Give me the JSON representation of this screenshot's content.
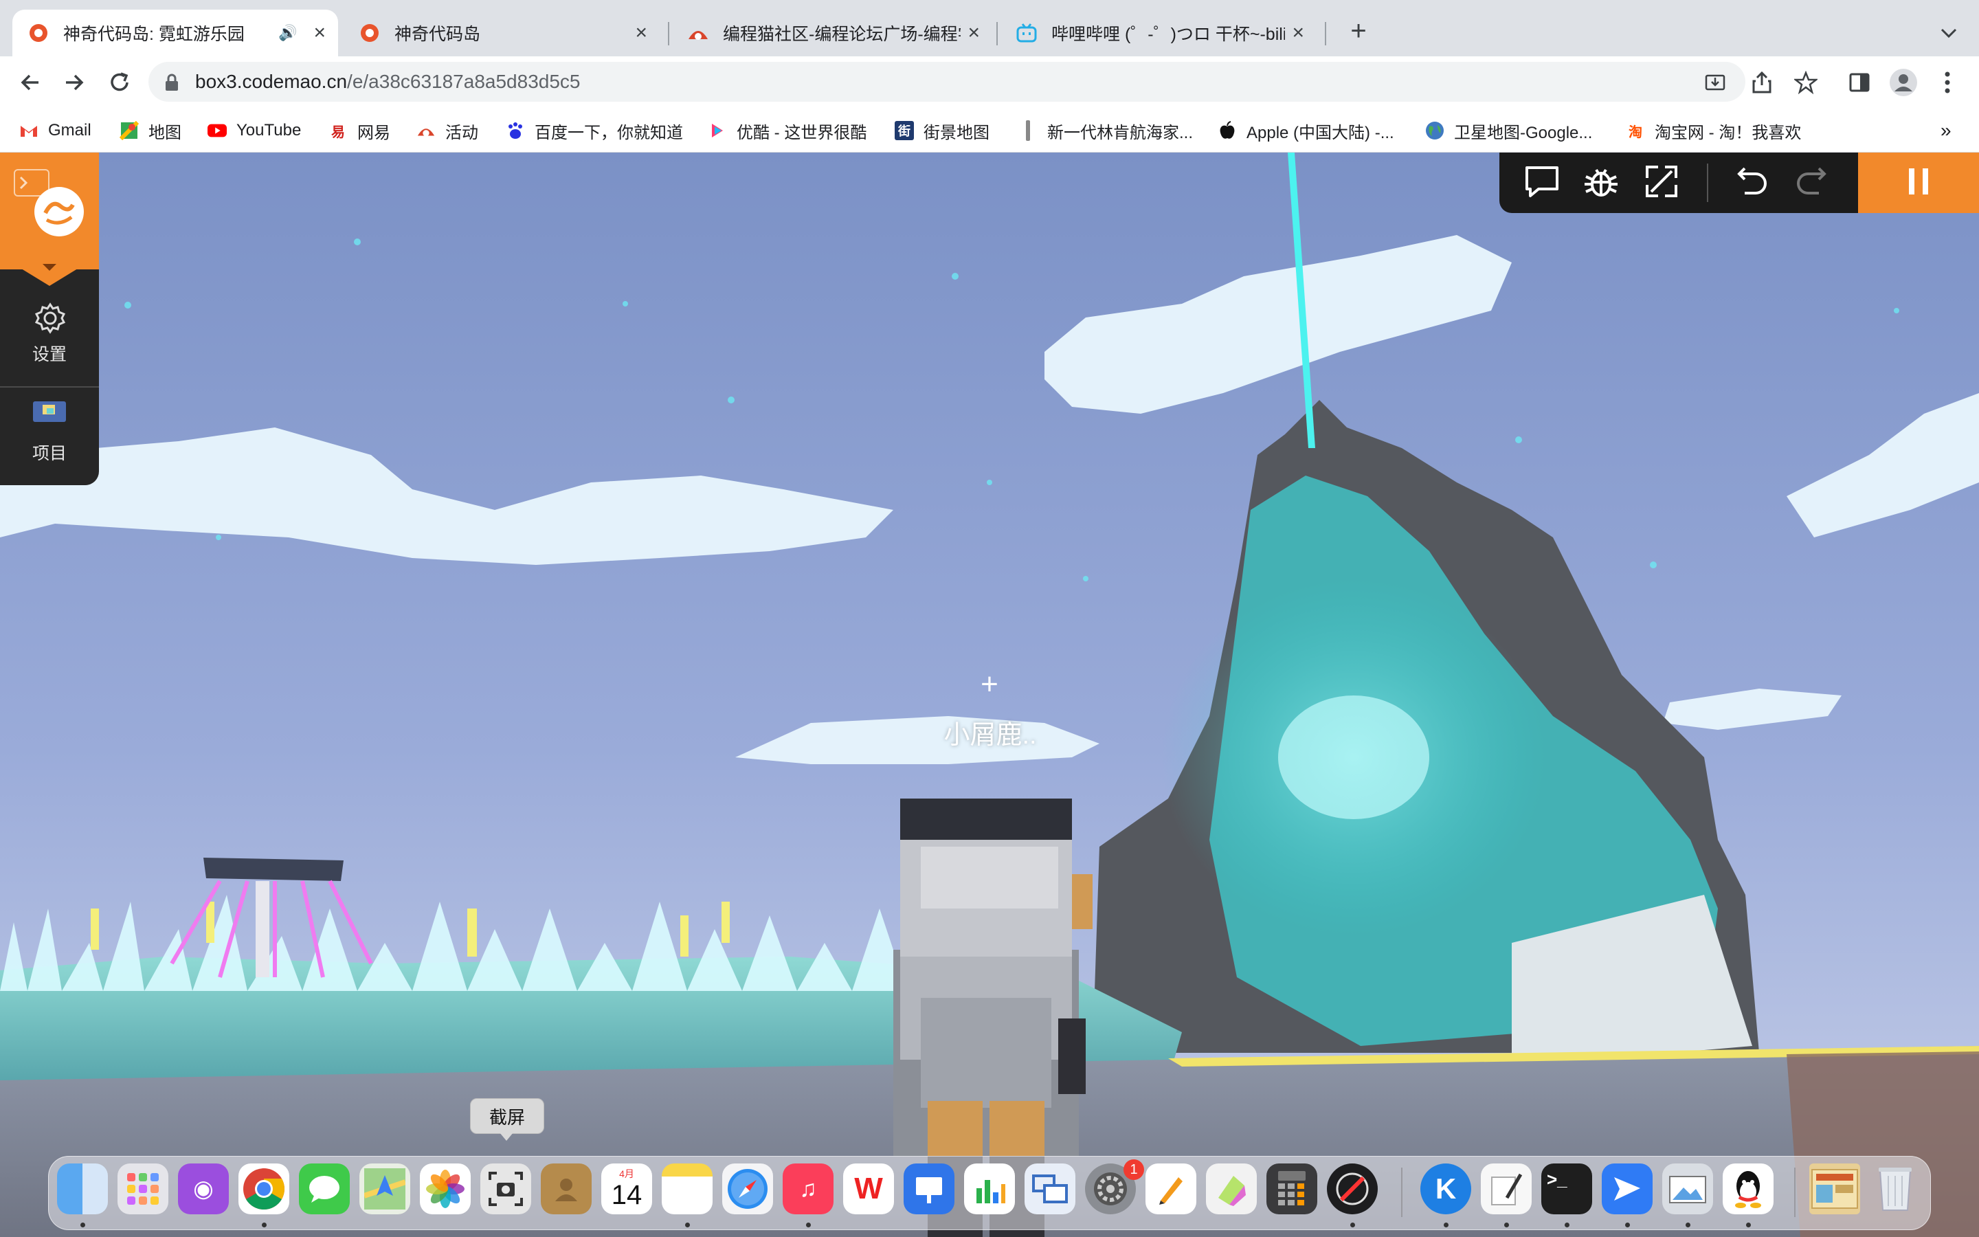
{
  "browser": {
    "tabs": [
      {
        "title": "神奇代码岛: 霓虹游乐园",
        "active": true,
        "audio": true,
        "icon": "codemao-favicon"
      },
      {
        "title": "神奇代码岛",
        "active": false,
        "icon": "codemao-favicon"
      },
      {
        "title": "编程猫社区-编程论坛广场-编程学",
        "active": false,
        "icon": "bcm-favicon"
      },
      {
        "title": "哔哩哔哩 (゜-゜)つロ 干杯~-bilibili",
        "active": false,
        "icon": "bilibili-favicon"
      }
    ],
    "new_tab_label": "+",
    "url_host": "box3.codemao.cn",
    "url_path": "/e/a38c63187a8a5d83d5c5",
    "bookmarks": [
      {
        "label": "Gmail",
        "icon": "gmail-icon"
      },
      {
        "label": "地图",
        "icon": "maps-icon"
      },
      {
        "label": "YouTube",
        "icon": "youtube-icon"
      },
      {
        "label": "网易",
        "icon": "netease-icon"
      },
      {
        "label": "活动",
        "icon": "activity-icon"
      },
      {
        "label": "百度一下，你就知道",
        "icon": "baidu-icon"
      },
      {
        "label": "优酷 - 这世界很酷",
        "icon": "youku-icon"
      },
      {
        "label": "街景地图",
        "icon": "streetview-icon"
      },
      {
        "label": "新一代林肯航海家...",
        "icon": "lincoln-icon"
      },
      {
        "label": "Apple (中国大陆) -...",
        "icon": "apple-icon"
      },
      {
        "label": "卫星地图-Google...",
        "icon": "earth-icon"
      },
      {
        "label": "淘宝网 - 淘！我喜欢",
        "icon": "taobao-icon"
      }
    ],
    "more_bookmarks": "»"
  },
  "game": {
    "sidebar": {
      "settings_label": "设置",
      "project_label": "项目"
    },
    "player_name": "小屑鹿..",
    "crosshair": "+"
  },
  "dock": {
    "tooltip": "截屏",
    "calendar_month": "4月",
    "calendar_day": "14",
    "settings_badge": "1"
  },
  "colors": {
    "accent_orange": "#f2892b",
    "sky_top": "#7d93c8",
    "sky_bottom": "#a9b8df",
    "neon_cyan": "#59f0f0"
  }
}
